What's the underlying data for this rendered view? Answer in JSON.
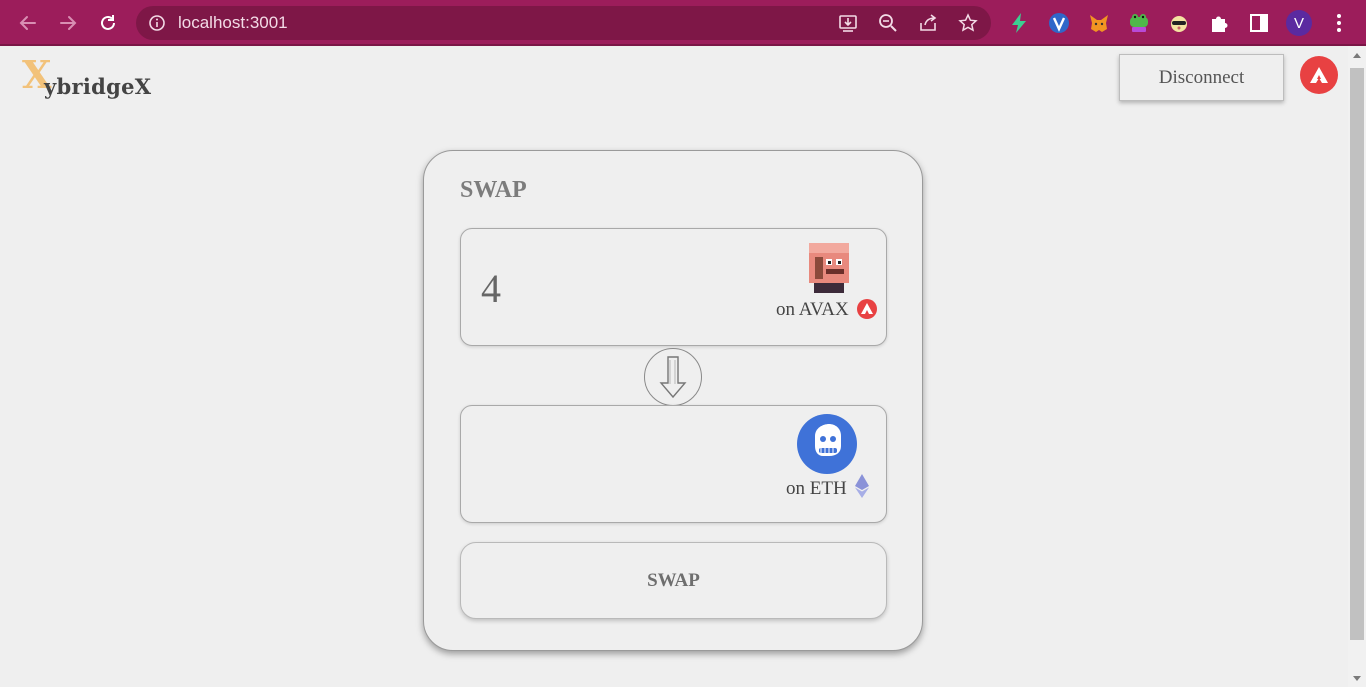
{
  "browser": {
    "url": "localhost:3001",
    "avatar_letter": "V",
    "nav_icons": [
      "back-arrow-icon",
      "forward-arrow-icon",
      "reload-icon"
    ],
    "omnibox_icons": [
      "site-info-icon",
      "install-app-icon",
      "zoom-icon",
      "share-icon",
      "bookmark-star-icon"
    ],
    "extensions": [
      "bolt-extension-icon",
      "v-extension-icon",
      "metamask-fox-icon",
      "frog-extension-icon",
      "cat-extension-icon",
      "puzzle-extensions-icon",
      "side-panel-icon"
    ],
    "menu_icon": "kebab-menu-icon",
    "colors": {
      "toolbar": "#9c1d5b",
      "omnibox": "#7e1747",
      "avatar": "#5b2aa0"
    }
  },
  "header": {
    "logo_x": "X",
    "logo_text": "ybridgeX",
    "disconnect_label": "Disconnect",
    "network_icon": "avalanche-icon",
    "colors": {
      "logo_accent": "#f2c27a",
      "avalanche": "#e84142"
    }
  },
  "swap_card": {
    "title": "SWAP",
    "from": {
      "amount": "4",
      "chain_label": "on AVAX",
      "token_icon": "pixel-character-nft-icon",
      "chain_icon": "avalanche-icon"
    },
    "direction_icon": "arrow-down-icon",
    "to": {
      "amount": "",
      "chain_label": "on ETH",
      "token_icon": "ape-nft-icon",
      "chain_icon": "ethereum-icon"
    },
    "swap_button_label": "SWAP"
  }
}
